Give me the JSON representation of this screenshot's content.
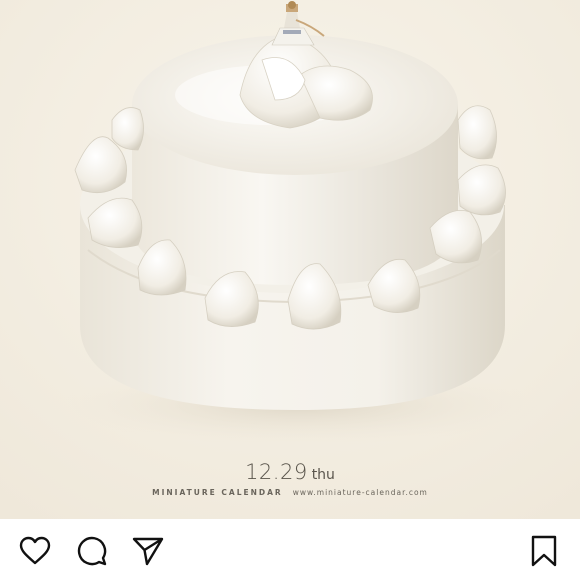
{
  "post": {
    "image_alt": "miniature figure dancing on a white two-tier cake",
    "caption": {
      "date": "12.29",
      "day": "thu",
      "brand": "MINIATURE CALENDAR",
      "website": "www.miniature-calendar.com"
    }
  },
  "actions": {
    "like_icon": "heart-icon",
    "comment_icon": "comment-icon",
    "share_icon": "paper-plane-icon",
    "save_icon": "bookmark-icon"
  },
  "colors": {
    "background": "#f4efe4",
    "cake": "#f6f3ec",
    "icon": "#111111"
  }
}
